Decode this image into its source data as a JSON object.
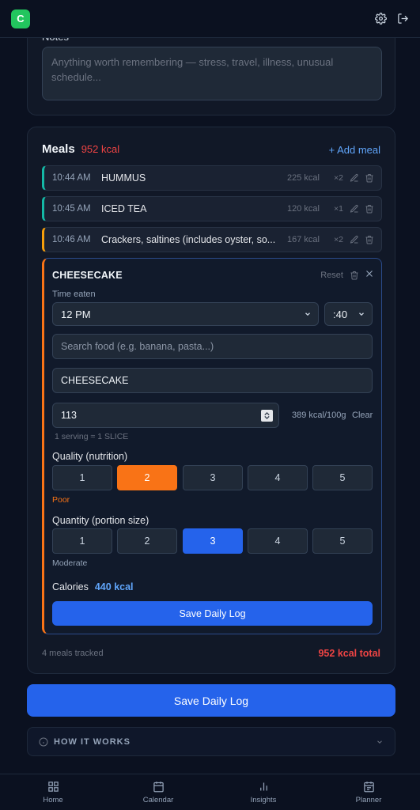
{
  "app": {
    "logo_letter": "C"
  },
  "notes": {
    "label": "Notes",
    "placeholder": "Anything worth remembering — stress, travel, illness, unusual schedule..."
  },
  "meals": {
    "title": "Meals",
    "total_kcal": "952 kcal",
    "add_label": "+ Add meal",
    "items": [
      {
        "time": "10:44 AM",
        "name": "HUMMUS",
        "kcal": "225 kcal",
        "mult": "×2"
      },
      {
        "time": "10:45 AM",
        "name": "ICED TEA",
        "kcal": "120 kcal",
        "mult": "×1"
      },
      {
        "time": "10:46 AM",
        "name": "Crackers, saltines (includes oyster, so...",
        "kcal": "167 kcal",
        "mult": "×2"
      }
    ],
    "footer_count": "4 meals tracked",
    "footer_total": "952 kcal total"
  },
  "editor": {
    "food_title": "CHEESECAKE",
    "reset_label": "Reset",
    "time_label": "Time eaten",
    "hour_value": "12 PM",
    "minute_value": ":40",
    "search_placeholder": "Search food (e.g. banana, pasta...)",
    "food_value": "CHEESECAKE",
    "grams_value": "113",
    "kcal_per_100g": "389 kcal/100g",
    "clear_label": "Clear",
    "serving_note": "1 serving ≈ 1 SLICE",
    "quality_title": "Quality (nutrition)",
    "quality_options": [
      "1",
      "2",
      "3",
      "4",
      "5"
    ],
    "quality_selected": 2,
    "quality_note": "Poor",
    "quantity_title": "Quantity (portion size)",
    "quantity_options": [
      "1",
      "2",
      "3",
      "4",
      "5"
    ],
    "quantity_selected": 3,
    "quantity_note": "Moderate",
    "calories_label": "Calories",
    "calories_value": "440 kcal",
    "save_label": "Save Daily Log"
  },
  "actions": {
    "save_label": "Save Daily Log",
    "how_it_works": "HOW IT WORKS"
  },
  "nav": {
    "home": "Home",
    "calendar": "Calendar",
    "insights": "Insights",
    "planner": "Planner"
  },
  "colors": {
    "accent_blue": "#2563eb",
    "quality_orange": "#f97316",
    "kcal_red": "#ef4444",
    "logo_green": "#22c55e"
  },
  "icons": [
    "gear-icon",
    "logout-icon",
    "pencil-icon",
    "trash-icon",
    "close-icon",
    "chevron-down-icon",
    "info-icon",
    "home-icon",
    "calendar-icon",
    "insights-icon",
    "planner-icon"
  ]
}
